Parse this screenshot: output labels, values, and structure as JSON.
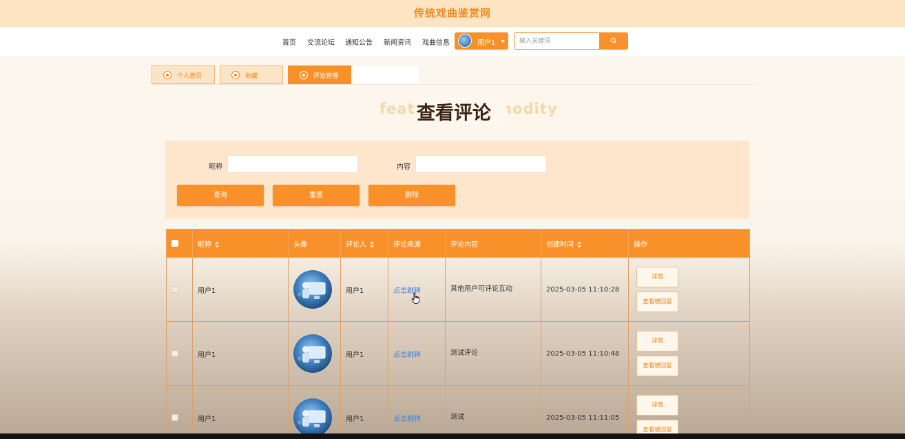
{
  "site_title": "传统戏曲鉴赏网",
  "nav": {
    "items": [
      {
        "label": "首页"
      },
      {
        "label": "交流论坛"
      },
      {
        "label": "通知公告"
      },
      {
        "label": "新闻资讯"
      },
      {
        "label": "戏曲信息"
      }
    ],
    "user_label": "用户1",
    "search_placeholder": "输入关键词"
  },
  "tabs": [
    {
      "label": "个人首页"
    },
    {
      "label": "收藏"
    },
    {
      "label": "评论管理"
    }
  ],
  "page_title": {
    "main": "查看评论",
    "background": "featured commodity"
  },
  "filter": {
    "nickname_label": "昵称",
    "nickname_value": "",
    "content_label": "内容",
    "content_value": "",
    "query_label": "查询",
    "reset_label": "重置",
    "delete_label": "删除"
  },
  "table": {
    "headers": [
      "昵称",
      "头像",
      "评论人",
      "评论来源",
      "评论内容",
      "创建时间",
      "操作"
    ],
    "rows": [
      {
        "nickname": "用户1",
        "commenter": "用户1",
        "source_link": "点击跳转",
        "content": "其他用户可评论互动",
        "created": "2025-03-05 11:10:28",
        "detail_label": "详情",
        "reply_label": "查看被回复"
      },
      {
        "nickname": "用户1",
        "commenter": "用户1",
        "source_link": "点击跳转",
        "content": "测试评论",
        "created": "2025-03-05 11:10:48",
        "detail_label": "详情",
        "reply_label": "查看被回复"
      },
      {
        "nickname": "用户1",
        "commenter": "用户1",
        "source_link": "点击跳转",
        "content": "测试",
        "created": "2025-03-05 11:11:05",
        "detail_label": "详情",
        "reply_label": "查看被回复"
      }
    ]
  },
  "colors": {
    "accent": "#f8912a",
    "topbar": "#fde5c3",
    "panel": "#fde6cc",
    "link": "#3b7fd8"
  }
}
